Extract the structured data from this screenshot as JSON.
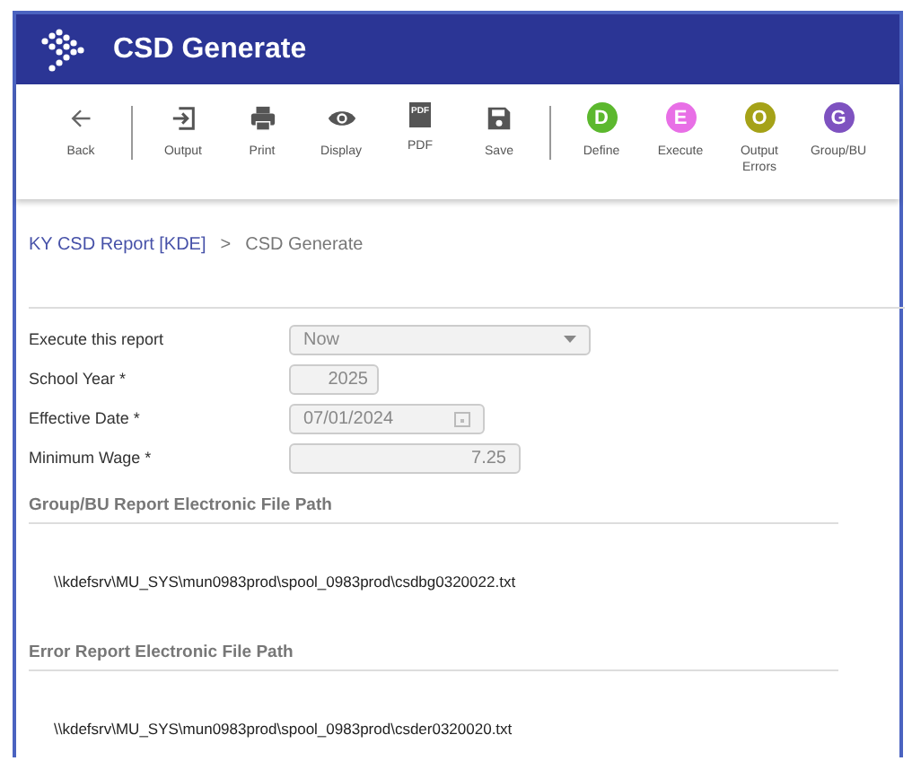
{
  "window": {
    "title": "CSD Generate"
  },
  "toolbar": {
    "groups": [
      [
        {
          "kind": "icon",
          "label": "Back"
        }
      ],
      [
        {
          "kind": "icon",
          "label": "Output"
        },
        {
          "kind": "icon",
          "label": "Print"
        },
        {
          "kind": "icon",
          "label": "Display"
        },
        {
          "kind": "icon",
          "label": "PDF",
          "icon_text": "PDF"
        },
        {
          "kind": "icon",
          "label": "Save"
        }
      ],
      [
        {
          "kind": "letter",
          "letter": "D",
          "label": "Define",
          "color": "#5cb82e"
        },
        {
          "kind": "letter",
          "letter": "E",
          "label": "Execute",
          "color": "#e86fe6"
        },
        {
          "kind": "letter",
          "letter": "O",
          "label": "Output Errors",
          "color": "#a5a218"
        },
        {
          "kind": "letter",
          "letter": "G",
          "label": "Group/BU",
          "color": "#7e52c0"
        }
      ]
    ]
  },
  "breadcrumb": [
    {
      "text": "KY CSD Report [KDE]",
      "kind": "link"
    },
    {
      "text": ">",
      "kind": "separator"
    },
    {
      "text": "CSD Generate",
      "kind": "current"
    }
  ],
  "form": [
    {
      "label": "Execute this report",
      "kind": "select",
      "value": "Now",
      "disabled": true
    },
    {
      "label": "School Year *",
      "kind": "number",
      "value": "2025",
      "disabled": true
    },
    {
      "label": "Effective Date *",
      "kind": "date",
      "value": "07/01/2024",
      "disabled": true
    },
    {
      "label": "Minimum Wage *",
      "kind": "amount",
      "value": "7.25",
      "disabled": true
    }
  ],
  "sections": [
    {
      "title": "Group/BU Report Electronic File Path",
      "path": "\\\\kdefsrv\\MU_SYS\\mun0983prod\\spool_0983prod\\csdbg0320022.txt"
    },
    {
      "title": "Error Report Electronic File Path",
      "path": "\\\\kdefsrv\\MU_SYS\\mun0983prod\\spool_0983prod\\csder0320020.txt"
    }
  ]
}
